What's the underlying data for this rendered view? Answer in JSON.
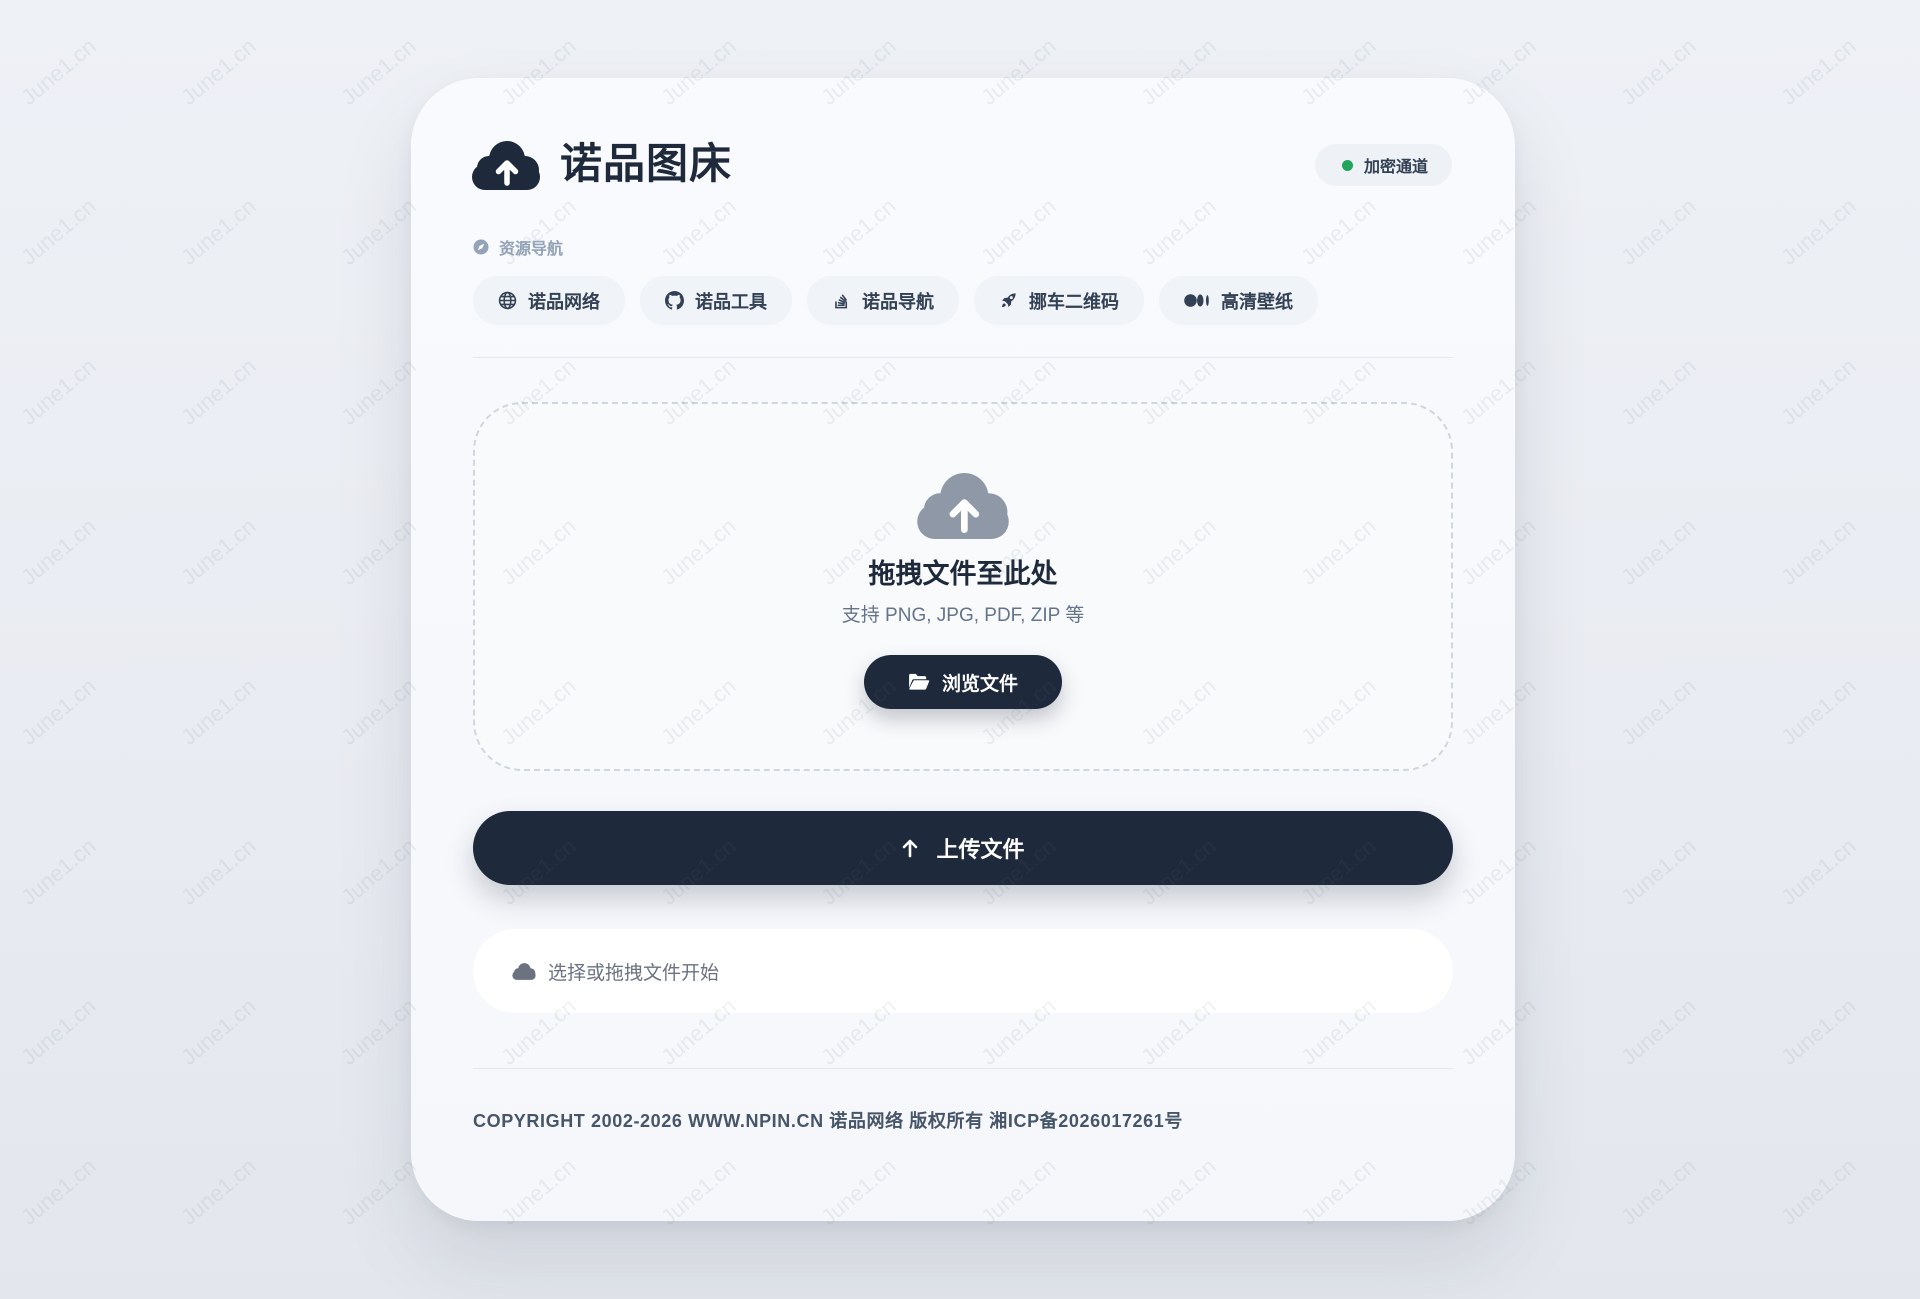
{
  "watermark": {
    "text": "June1.cn"
  },
  "header": {
    "logo_icon": "cloud-upload-icon",
    "title": "诺品图床",
    "badge": {
      "label": "加密通道",
      "status": "online"
    }
  },
  "nav": {
    "label": "资源导航",
    "label_icon": "compass-icon",
    "items": [
      {
        "label": "诺品网络",
        "icon": "globe-icon"
      },
      {
        "label": "诺品工具",
        "icon": "github-icon"
      },
      {
        "label": "诺品导航",
        "icon": "stack-icon"
      },
      {
        "label": "挪车二维码",
        "icon": "rocket-icon"
      },
      {
        "label": "高清壁纸",
        "icon": "medium-icon"
      }
    ]
  },
  "dropzone": {
    "icon": "cloud-upload-icon",
    "title": "拖拽文件至此处",
    "subtitle": "支持 PNG, JPG, PDF, ZIP 等",
    "browse_label": "浏览文件",
    "browse_icon": "folder-open-icon"
  },
  "upload": {
    "label": "上传文件",
    "icon": "arrow-up-icon"
  },
  "status": {
    "icon": "cloud-icon",
    "text": "选择或拖拽文件开始"
  },
  "footer": {
    "copyright": "COPYRIGHT 2002-2026 WWW.NPIN.CN 诺品网络 版权所有 湘ICP备2026017261号"
  },
  "colors": {
    "primary": "#1e293b",
    "badge_dot": "#22a55b",
    "muted": "#64748b"
  }
}
